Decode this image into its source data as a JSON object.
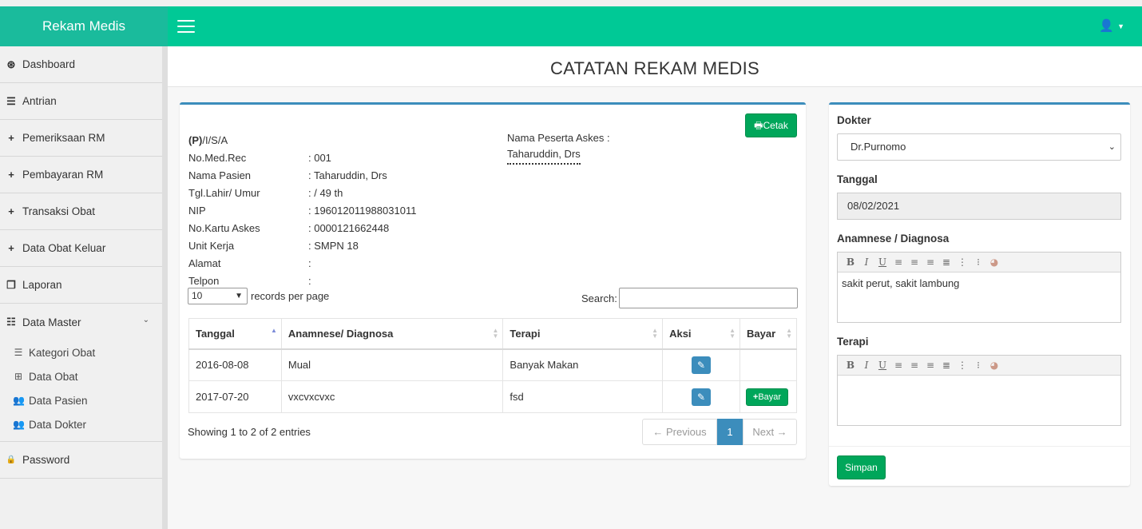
{
  "brand": "Rekam Medis",
  "sidebar": {
    "items": [
      {
        "icon": "dashboard-icon",
        "glyph": "⊛",
        "label": "Dashboard"
      },
      {
        "icon": "bars-icon",
        "glyph": "☰",
        "label": "Antrian"
      },
      {
        "icon": "plus-icon",
        "glyph": "+",
        "label": "Pemeriksaan RM"
      },
      {
        "icon": "plus-icon",
        "glyph": "+",
        "label": "Pembayaran RM"
      },
      {
        "icon": "plus-icon",
        "glyph": "+",
        "label": "Transaksi Obat"
      },
      {
        "icon": "plus-icon",
        "glyph": "+",
        "label": "Data Obat Keluar"
      },
      {
        "icon": "copy-icon",
        "glyph": "❐",
        "label": "Laporan"
      }
    ],
    "master": {
      "label": "Data Master",
      "glyph": "☷"
    },
    "sub_items": [
      {
        "glyph": "☰",
        "label": "Kategori Obat"
      },
      {
        "glyph": "⊞",
        "label": "Data Obat"
      },
      {
        "glyph": "👥",
        "label": "Data Pasien"
      },
      {
        "glyph": "👥",
        "label": "Data Dokter"
      }
    ],
    "password": {
      "label": "Password",
      "glyph": "🔒"
    }
  },
  "page": {
    "title": "CATATAN REKAM MEDIS"
  },
  "patient": {
    "heading_bold": "(P)",
    "heading_rest": "/I/S/A",
    "rows": [
      {
        "label": "No.Med.Rec",
        "value": ": 001"
      },
      {
        "label": "Nama Pasien",
        "value": ": Taharuddin, Drs"
      },
      {
        "label": "Tgl.Lahir/ Umur",
        "value": ": / 49 th"
      },
      {
        "label": "NIP",
        "value": ": 196012011988031011"
      },
      {
        "label": "No.Kartu Askes",
        "value": ": 0000121662448"
      },
      {
        "label": "Unit Kerja",
        "value": ": SMPN 18"
      },
      {
        "label": "Alamat",
        "value": ":"
      },
      {
        "label": "Telpon",
        "value": ":"
      }
    ],
    "askes_label": "Nama Peserta Askes :",
    "askes_name": "Taharuddin, Drs"
  },
  "toolbar": {
    "print_label": "Cetak"
  },
  "table": {
    "length_value": "10",
    "length_suffix": "records per page",
    "search_label": "Search:",
    "headers": [
      "Tanggal",
      "Anamnese/ Diagnosa",
      "Terapi",
      "Aksi",
      "Bayar"
    ],
    "rows": [
      {
        "tanggal": "2016-08-08",
        "diagnosa": "Mual",
        "terapi": "Banyak Makan",
        "bayar": ""
      },
      {
        "tanggal": "2017-07-20",
        "diagnosa": "vxcvxcvxc",
        "terapi": "fsd",
        "bayar": "Bayar"
      }
    ],
    "info": "Showing 1 to 2 of 2 entries",
    "pager": {
      "prev": "← Previous",
      "current": "1",
      "next": "Next →"
    }
  },
  "form": {
    "doctor_label": "Dokter",
    "doctor_value": "Dr.Purnomo",
    "date_label": "Tanggal",
    "date_value": "08/02/2021",
    "diagnosa_label": "Anamnese / Diagnosa",
    "diagnosa_value": "sakit perut, sakit lambung",
    "terapi_label": "Terapi",
    "terapi_value": "",
    "save_label": "Simpan"
  },
  "colors": {
    "brand": "#1abb9c",
    "navbar": "#00c996",
    "primary": "#3c8dbc",
    "success": "#00a65a"
  }
}
